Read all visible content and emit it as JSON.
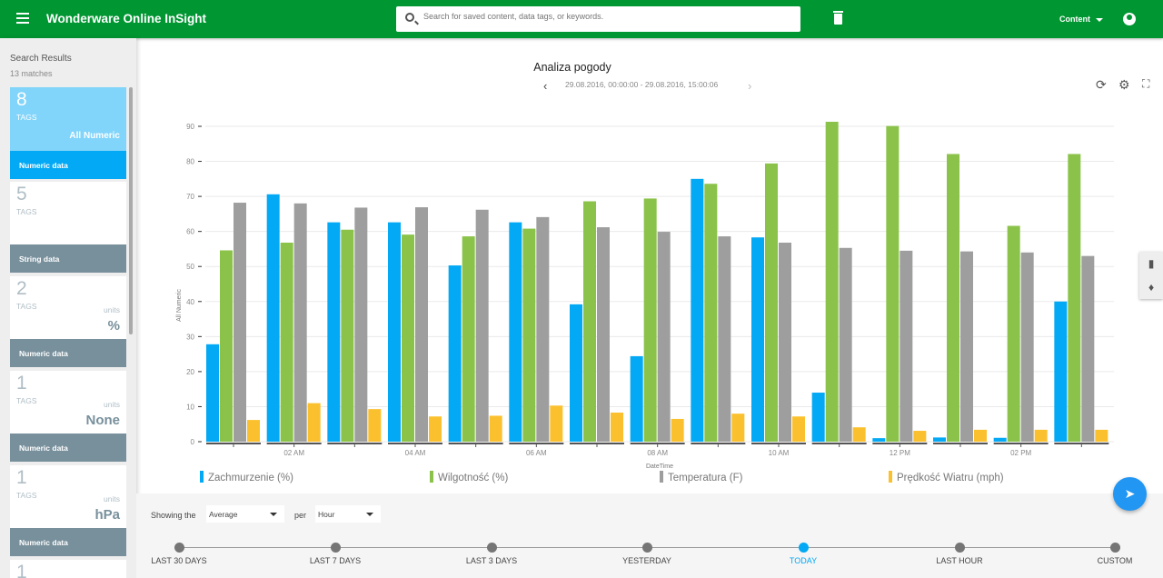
{
  "header": {
    "app_title": "Wonderware Online InSight",
    "search_placeholder": "Search for saved content, data tags, or keywords.",
    "content_label": "Content"
  },
  "sidebar": {
    "title": "Search Results",
    "count": "13 matches",
    "cards": [
      {
        "count": "8",
        "tags": "TAGS",
        "units_label": "",
        "units": "All Numeric",
        "type": "Numeric data",
        "selected": true
      },
      {
        "count": "5",
        "tags": "TAGS",
        "units_label": "",
        "units": "",
        "type": "String data"
      },
      {
        "count": "2",
        "tags": "TAGS",
        "units_label": "units",
        "units": "%",
        "type": "Numeric data"
      },
      {
        "count": "1",
        "tags": "TAGS",
        "units_label": "units",
        "units": "None",
        "type": "Numeric data"
      },
      {
        "count": "1",
        "tags": "TAGS",
        "units_label": "units",
        "units": "hPa",
        "type": "Numeric data"
      },
      {
        "count": "1"
      }
    ]
  },
  "chart_header": {
    "title": "Analiza pogody",
    "range": "29.08.2016, 00:00:00 - 29.08.2016, 15:00:06"
  },
  "chart_data": {
    "type": "bar",
    "xlabel": "DateTime",
    "ylabel": "All Numeric",
    "ylim": [
      0,
      90
    ],
    "yticks": [
      0,
      10,
      20,
      30,
      40,
      50,
      60,
      70,
      80,
      90
    ],
    "grid": true,
    "legend": "bottom",
    "categories": [
      "",
      "02 AM",
      "",
      "04 AM",
      "",
      "06 AM",
      "",
      "08 AM",
      "",
      "10 AM",
      "",
      "12 PM",
      "",
      "02 PM",
      ""
    ],
    "series": [
      {
        "name": "Zachmurzenie (%)",
        "color": "#03a9f4",
        "values": [
          27.8,
          70.6,
          62.6,
          62.6,
          50.3,
          62.6,
          39.2,
          24.4,
          75.0,
          58.3,
          14.0,
          1.0,
          1.2,
          1.1,
          40.0
        ]
      },
      {
        "name": "Wilgotność (%)",
        "color": "#8bc34a",
        "values": [
          54.6,
          56.8,
          60.5,
          59.1,
          58.6,
          60.8,
          68.6,
          69.4,
          73.6,
          79.4,
          91.3,
          90.1,
          82.1,
          61.6,
          82.1
        ]
      },
      {
        "name": "Temperatura (F)",
        "color": "#9e9e9e",
        "values": [
          68.2,
          68.0,
          66.8,
          66.9,
          66.2,
          64.1,
          61.2,
          59.9,
          58.6,
          56.8,
          55.3,
          54.5,
          54.3,
          54.0,
          53.0
        ]
      },
      {
        "name": "Prędkość Wiatru (mph)",
        "color": "#fbc02d",
        "values": [
          6.2,
          11.0,
          9.3,
          7.2,
          7.4,
          10.3,
          8.3,
          6.5,
          8.0,
          7.2,
          4.1,
          3.1,
          3.4,
          3.4,
          3.4
        ]
      }
    ]
  },
  "controls": {
    "showing_label": "Showing the",
    "aggregate": "Average",
    "per_label": "per",
    "interval": "Hour"
  },
  "timeline": {
    "options": [
      "LAST 30 DAYS",
      "LAST 7 DAYS",
      "LAST 3 DAYS",
      "YESTERDAY",
      "TODAY",
      "LAST HOUR",
      "CUSTOM"
    ],
    "selected": "TODAY",
    "accent": "#03a9f4"
  }
}
